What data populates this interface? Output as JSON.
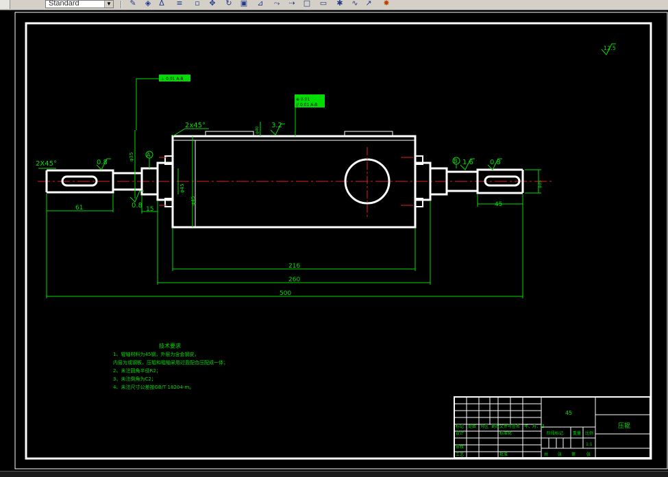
{
  "toolbar": {
    "style_value": "Standard",
    "icons": [
      "match-properties-icon",
      "snap-icon",
      "angular-dimension-icon",
      "text-style-icon",
      "group-icon",
      "pan-icon",
      "refresh-icon",
      "zoom-window-icon",
      "dimension-style-icon",
      "linear-dimension-icon",
      "aligned-dimension-icon",
      "layer-icon",
      "block-icon",
      "tolerance-icon",
      "spline-icon",
      "leader-icon",
      "explode-icon"
    ]
  },
  "drawing": {
    "dims": {
      "d61": "61",
      "d15": "15",
      "d216": "216",
      "d260": "260",
      "d500": "500",
      "d45": "45",
      "chamfer_left": "2X45°",
      "chamfer_mid": "2x45°",
      "d3_2": "3.2",
      "dia35_left": "φ35",
      "dia45": "φ45",
      "dia35_right": "φ35",
      "dia45_mid": "φ45",
      "sec_body": "φ40"
    },
    "roughness": {
      "r125": "12.5",
      "r08_a": "0.8",
      "r08_b": "0.8",
      "r08_c": "0.8",
      "r16": "1.6"
    },
    "datum_a": "A",
    "datum_b": "B",
    "tol_frame_1": "⊥ 0.01 A-B",
    "tol_frame_2a": "⊕ 0.01",
    "tol_frame_2b": "// 0.01 A-B"
  },
  "notes": {
    "title": "技术要求",
    "lines": [
      "1、辊轴材料为45钢，外层为含金钢皮，",
      "内层为或钢板，压辊和辊轴采用过盈配合压配成一体；",
      "2、未注圆角半径R2；",
      "3、未注倒角为C2；",
      "4、未注尺寸公差按GB/T 18204-m。"
    ]
  },
  "title_block": {
    "part_name": "压辊",
    "material": "45",
    "scale": "1:1",
    "scale_label": "比例",
    "weight_label": "重量",
    "stage_label": "阶段标记",
    "designer_label": "设计",
    "standard_label": "标准化",
    "process_label": "工艺",
    "approve_label": "批准",
    "review_label": "审核",
    "sheet_labels": [
      "共",
      "张",
      "第",
      "张"
    ],
    "header_cells": [
      "标记",
      "处数",
      "分区",
      "更改文件号",
      "签名",
      "年、月、日"
    ]
  }
}
